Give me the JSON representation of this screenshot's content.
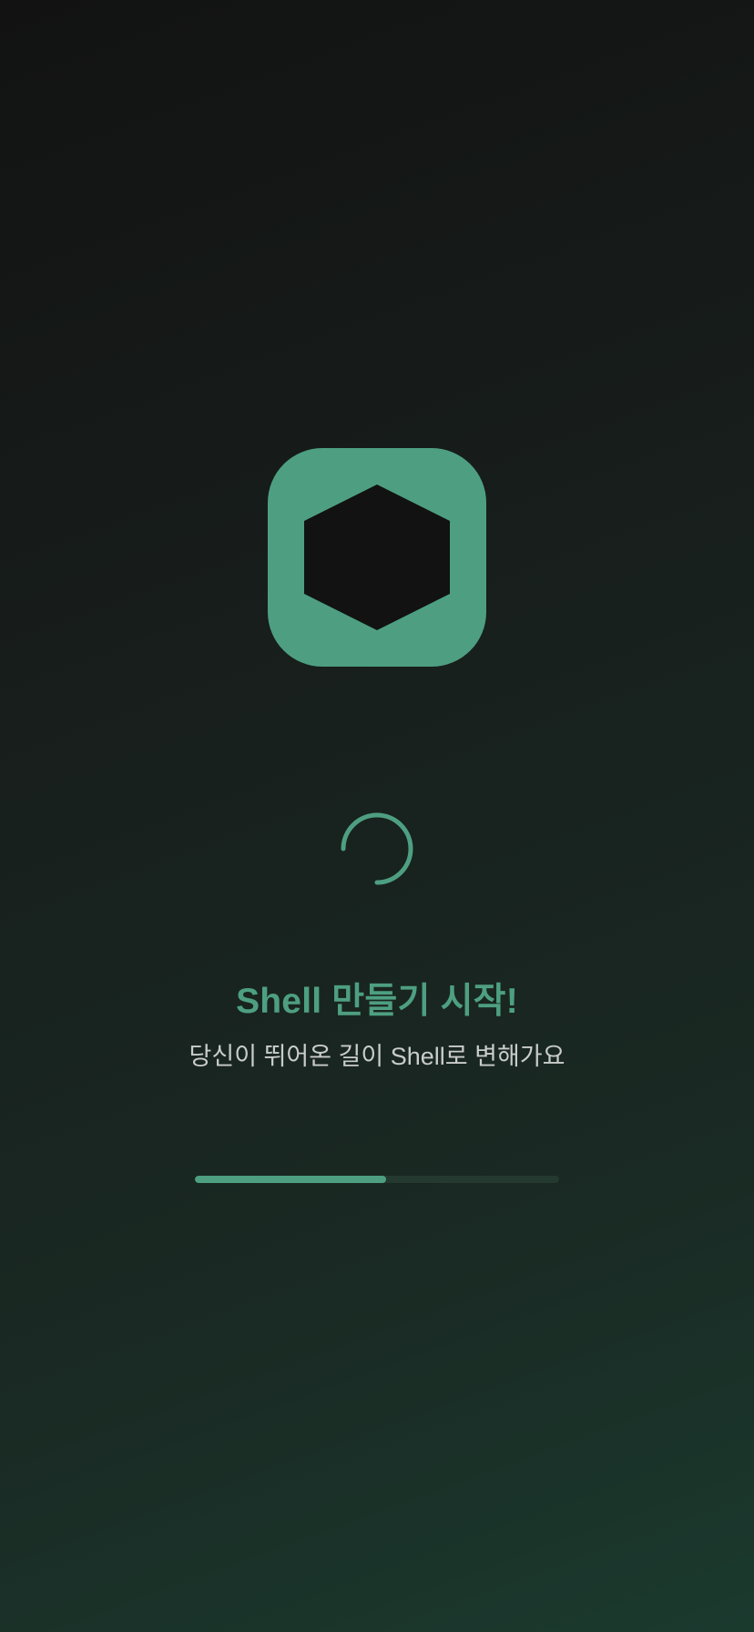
{
  "splash": {
    "logo_icon": "hexagon-icon",
    "spinner_icon": "loading-spinner-icon",
    "title": "Shell 만들기 시작!",
    "subtitle": "당신이 뛰어온 길이 Shell로 변해가요",
    "progress": 0.525
  },
  "colors": {
    "accent": "#4e9f82",
    "logo_hexagon": "#121212",
    "progress_track": "#24392f",
    "subtitle_text": "#c9cccb"
  }
}
